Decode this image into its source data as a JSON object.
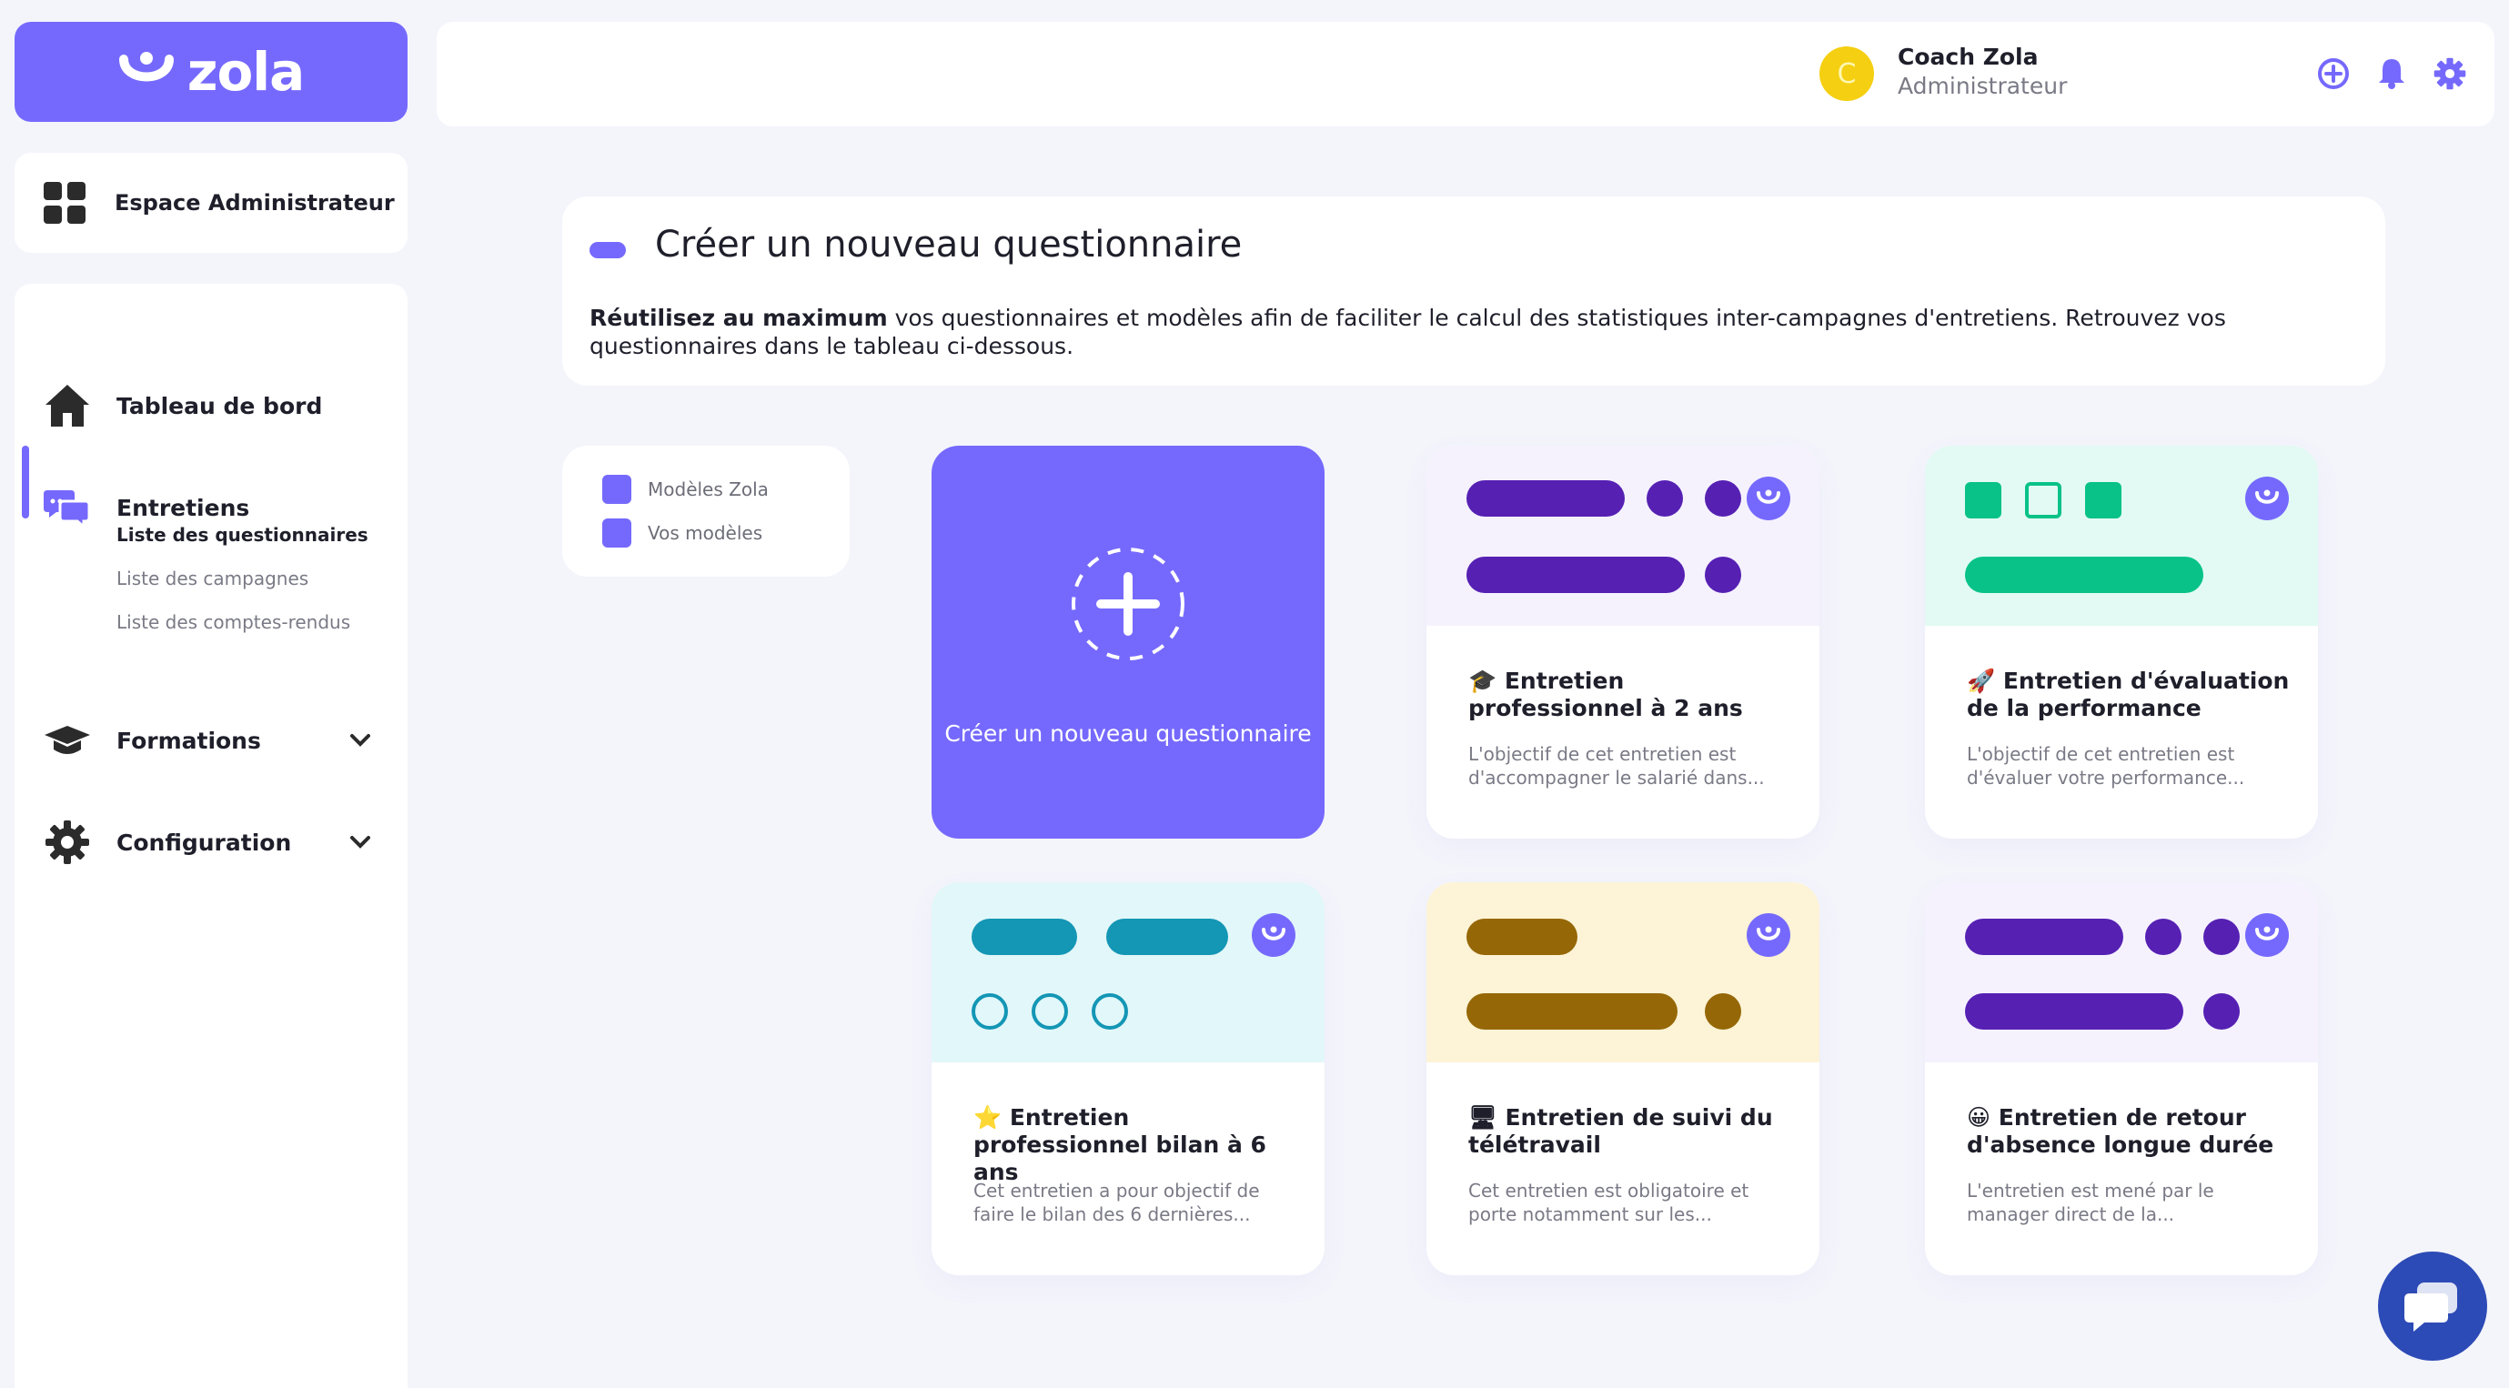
{
  "brand": {
    "logo_text": "zola",
    "accent_color": "#7569fd"
  },
  "sidebar": {
    "admin_space_label": "Espace Administrateur",
    "items": [
      {
        "label": "Tableau de bord",
        "icon": "home-icon"
      },
      {
        "label": "Entretiens",
        "icon": "chat-bubbles-icon",
        "subitems": [
          {
            "label": "Liste des questionnaires",
            "active": true
          },
          {
            "label": "Liste des campagnes",
            "active": false
          },
          {
            "label": "Liste des comptes-rendus",
            "active": false
          }
        ]
      },
      {
        "label": "Formations",
        "icon": "graduation-cap-icon"
      },
      {
        "label": "Configuration",
        "icon": "gear-icon"
      }
    ]
  },
  "header": {
    "avatar_letter": "C",
    "user_name": "Coach Zola",
    "user_role": "Administrateur",
    "icons": [
      "add-circle-icon",
      "bell-icon",
      "gear-icon"
    ]
  },
  "banner": {
    "title": "Créer un nouveau questionnaire",
    "desc_bold": "Réutilisez au maximum",
    "desc_rest": " vos questionnaires et modèles afin de faciliter le calcul des statistiques inter-campagnes d'entretiens. Retrouvez vos questionnaires dans le tableau ci-dessous."
  },
  "filters": [
    {
      "label": "Modèles Zola"
    },
    {
      "label": "Vos modèles"
    }
  ],
  "create_card": {
    "label": "Créer un nouveau questionnaire"
  },
  "cards": [
    {
      "emoji": "🎓",
      "title": "Entretien professionnel à 2 ans",
      "desc": "L'objectif de cet entretien est d'accompagner le salarié dans...",
      "bg": "#f5f2fe",
      "color": "#5620b3"
    },
    {
      "emoji": "🚀",
      "title": "Entretien d'évaluation de la performance",
      "desc": "L'objectif de cet entretien est d'évaluer votre performance...",
      "bg": "#e2faf3",
      "color": "#08c288"
    },
    {
      "emoji": "⭐",
      "title": "Entretien professionnel bilan à 6 ans",
      "desc": "Cet entretien a pour objectif de faire le bilan des 6 dernières...",
      "bg": "#e2f7f9",
      "color": "#1496b5"
    },
    {
      "emoji": "🖥",
      "title": "Entretien de suivi du télétravail",
      "desc": "Cet entretien est obligatoire et porte notamment sur les...",
      "bg": "#fdf3d6",
      "color": "#956706"
    },
    {
      "emoji": "😀",
      "title": "Entretien de retour d'absence longue durée",
      "desc": "L'entretien est mené par le manager direct de la...",
      "bg": "#f5f2fe",
      "color": "#5620b3"
    }
  ]
}
